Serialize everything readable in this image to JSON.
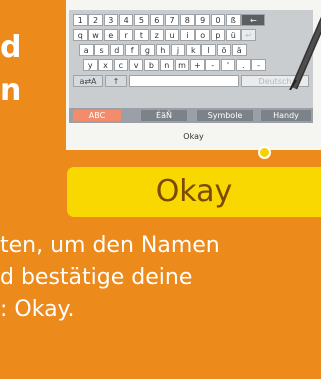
{
  "left_glyphs": [
    "d",
    "n"
  ],
  "keyboard": {
    "rows": [
      [
        "1",
        "2",
        "3",
        "4",
        "5",
        "6",
        "7",
        "8",
        "9",
        "0",
        "ß",
        "←"
      ],
      [
        "q",
        "w",
        "e",
        "r",
        "t",
        "z",
        "u",
        "i",
        "o",
        "p",
        "ü",
        "↵"
      ],
      [
        "a",
        "s",
        "d",
        "f",
        "g",
        "h",
        "j",
        "k",
        "l",
        "ö",
        "ä"
      ],
      [
        "y",
        "x",
        "c",
        "v",
        "b",
        "n",
        "m",
        "+",
        "-",
        "'",
        ".",
        "-"
      ]
    ],
    "shift_label": "a⇄A",
    "up_label": "↑",
    "lang_label": "Deutsch"
  },
  "modes": [
    "ABC",
    "ÉäÑ",
    "Symbole",
    "Handy"
  ],
  "okay_small": "Okay",
  "okay_big": "Okay",
  "description": [
    "ten, um den Namen",
    "d bestätige deine",
    ": Okay."
  ]
}
